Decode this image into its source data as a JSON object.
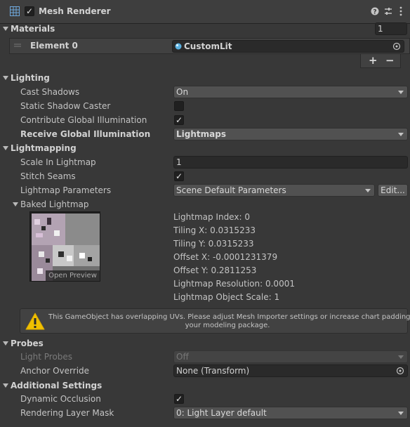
{
  "header": {
    "title": "Mesh Renderer",
    "enabled": true
  },
  "materials": {
    "section": "Materials",
    "size": "1",
    "element_label": "Element 0",
    "element_value": "CustomLit",
    "add": "+",
    "remove": "−"
  },
  "lighting": {
    "section": "Lighting",
    "cast_shadows_label": "Cast Shadows",
    "cast_shadows_value": "On",
    "static_shadow_label": "Static Shadow Caster",
    "static_shadow_checked": false,
    "contribute_gi_label": "Contribute Global Illumination",
    "contribute_gi_checked": true,
    "receive_gi_label": "Receive Global Illumination",
    "receive_gi_value": "Lightmaps"
  },
  "lightmapping": {
    "section": "Lightmapping",
    "scale_label": "Scale In Lightmap",
    "scale_value": "1",
    "stitch_label": "Stitch Seams",
    "stitch_checked": true,
    "params_label": "Lightmap Parameters",
    "params_value": "Scene Default Parameters",
    "edit_button": "Edit...",
    "baked_label": "Baked Lightmap",
    "preview_label": "Open Preview",
    "info": [
      "Lightmap Index: 0",
      "Tiling X: 0.0315233",
      "Tiling Y: 0.0315233",
      "Offset X: -0.0001231379",
      "Offset Y: 0.2811253",
      "Lightmap Resolution: 0.0001",
      "Lightmap Object Scale: 1"
    ],
    "warning_line1": "This GameObject has overlapping UVs. Please adjust Mesh Importer settings or increase chart padding in",
    "warning_line2": "your modeling package."
  },
  "probes": {
    "section": "Probes",
    "light_probes_label": "Light Probes",
    "light_probes_value": "Off",
    "anchor_label": "Anchor Override",
    "anchor_value": "None (Transform)"
  },
  "additional": {
    "section": "Additional Settings",
    "dynamic_occlusion_label": "Dynamic Occlusion",
    "dynamic_occlusion_checked": true,
    "rendering_layer_label": "Rendering Layer Mask",
    "rendering_layer_value": "0: Light Layer default"
  },
  "colors": {
    "background": "#383838",
    "warning": "#f0c000",
    "field": "#2a2a2a"
  }
}
